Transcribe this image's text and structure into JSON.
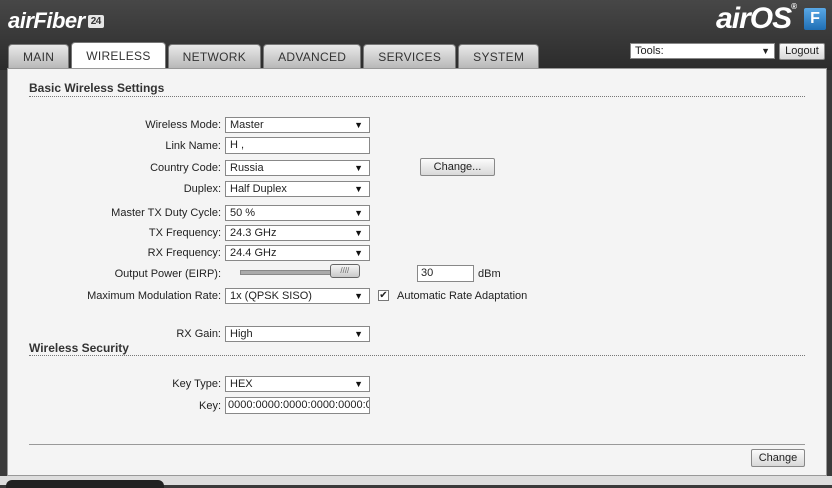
{
  "brand": {
    "left_logo": "airFiber",
    "left_badge": "24",
    "right_logo": "airOS",
    "right_mark": "®",
    "right_badge": "F"
  },
  "tabs": [
    {
      "label": "MAIN",
      "active": false
    },
    {
      "label": "WIRELESS",
      "active": true
    },
    {
      "label": "NETWORK",
      "active": false
    },
    {
      "label": "ADVANCED",
      "active": false
    },
    {
      "label": "SERVICES",
      "active": false
    },
    {
      "label": "SYSTEM",
      "active": false
    }
  ],
  "header": {
    "tools_value": "Tools:",
    "logout_label": "Logout"
  },
  "basic": {
    "title": "Basic Wireless Settings",
    "wireless_mode": {
      "label": "Wireless Mode:",
      "value": "Master"
    },
    "link_name": {
      "label": "Link Name:",
      "value": "H ,"
    },
    "country_code": {
      "label": "Country Code:",
      "value": "Russia",
      "change_label": "Change..."
    },
    "duplex": {
      "label": "Duplex:",
      "value": "Half Duplex"
    },
    "duty_cycle": {
      "label": "Master TX Duty Cycle:",
      "value": "50 %"
    },
    "tx_freq": {
      "label": "TX Frequency:",
      "value": "24.3 GHz"
    },
    "rx_freq": {
      "label": "RX Frequency:",
      "value": "24.4 GHz"
    },
    "output_power": {
      "label": "Output Power (EIRP):",
      "value": "30",
      "unit": "dBm",
      "slider_fraction": 0.88
    },
    "modulation": {
      "label": "Maximum Modulation Rate:",
      "value": "1x (QPSK SISO)",
      "auto_label": "Automatic Rate Adaptation",
      "auto_checked": true
    },
    "rx_gain": {
      "label": "RX Gain:",
      "value": "High"
    }
  },
  "security": {
    "title": "Wireless Security",
    "key_type": {
      "label": "Key Type:",
      "value": "HEX"
    },
    "key": {
      "label": "Key:",
      "value": "0000:0000:0000:0000:0000:0"
    }
  },
  "footer": {
    "change_label": "Change"
  },
  "icons": {
    "dropdown": "triangle-down",
    "check": "checkmark"
  }
}
